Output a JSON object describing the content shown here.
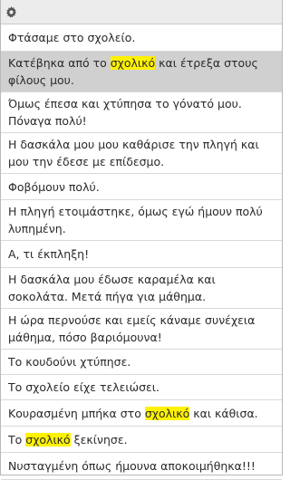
{
  "toolbar": {
    "settings_icon": "gear-icon"
  },
  "highlight_color": "#fff200",
  "selected_row": 1,
  "rows": [
    {
      "text": "Φτάσαμε στο σχολείο."
    },
    {
      "pre": "Κατέβηκα από το ",
      "hl": "σχολικό",
      "post": " και έτρεξα στους φίλους μου."
    },
    {
      "text": "Όμως έπεσα και χτύπησα το γόνατό μου. Πόναγα πολύ!"
    },
    {
      "text": "Η δασκάλα μου μου καθάρισε την πληγή και μου την έδεσε με επίδεσμο."
    },
    {
      "text": "Φοβόμουν πολύ."
    },
    {
      "text": "Η πληγή ετοιμάστηκε, όμως εγώ ήμουν πολύ λυπημένη."
    },
    {
      "text": "Α, τι έκπληξη!"
    },
    {
      "text": "Η δασκάλα μου έδωσε καραμέλα και σοκολάτα. Μετά πήγα για μάθημα."
    },
    {
      "text": "Η ώρα περνούσε και εμείς κάναμε συνέχεια μάθημα, πόσο βαριόμουνα!"
    },
    {
      "text": "Το κουδούνι χτύπησε."
    },
    {
      "text": "Το σχολείο είχε τελειώσει."
    },
    {
      "pre": "Κουρασμένη μπήκα στο ",
      "hl": "σχολικό",
      "post": " και κάθισα."
    },
    {
      "pre": "Το ",
      "hl": "σχολικό",
      "post": " ξεκίνησε."
    },
    {
      "text": "Νυσταγμένη όπως ήμουνα αποκοιμήθηκα!!!"
    }
  ]
}
